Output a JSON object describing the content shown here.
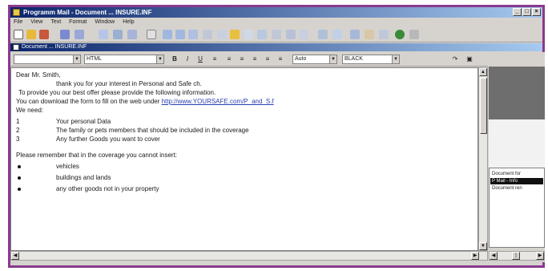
{
  "window": {
    "title": "Programm Mail - Document ... INSURE.INF",
    "min_glyph": "_",
    "max_glyph": "□",
    "close_glyph": "×"
  },
  "menu": [
    "File",
    "View",
    "Text",
    "Format",
    "Window",
    "Help"
  ],
  "document_window": {
    "title": "Document ... INSURE.INF"
  },
  "format_bar": {
    "style_value": "",
    "font_value": "HTML",
    "bold": "B",
    "italic": "I",
    "underline": "U",
    "size_value": "Auto",
    "color_value": "BLACK"
  },
  "letter": {
    "salutation": "Dear Mr. Smith,",
    "line1": "thank you for your interest in Personal and Safe ch.",
    "line2": "To provide you our best offer please provide the following information.",
    "line3_prefix": "You can download the form to fill on the web under ",
    "link": "http://www.YOURSAFE.com/P_and_S.f",
    "we_need": "We need:",
    "numbered": [
      {
        "num": "1",
        "text": "Your personal Data"
      },
      {
        "num": "2",
        "text": "The family or pets members that should be included in the coverage"
      },
      {
        "num": "3",
        "text": "Any further Goods you want to cover"
      }
    ],
    "remember": "Please remember that in the coverage you cannot insert:",
    "bullets": [
      "vehicles",
      "buildings and lands",
      "any other goods not in your property"
    ]
  },
  "right_panel": {
    "items": [
      {
        "label": "Document for",
        "selected": false
      },
      {
        "label": "P Mail - Info",
        "selected": true
      },
      {
        "label": "Document ren",
        "selected": false
      }
    ]
  },
  "icons": {
    "app": "app-icon",
    "document": "document-icon"
  },
  "colors": {
    "frame_border": "#8a3a8e",
    "titlebar_start": "#0a246a",
    "titlebar_end": "#a6caf0",
    "link": "#2a3fb0"
  }
}
